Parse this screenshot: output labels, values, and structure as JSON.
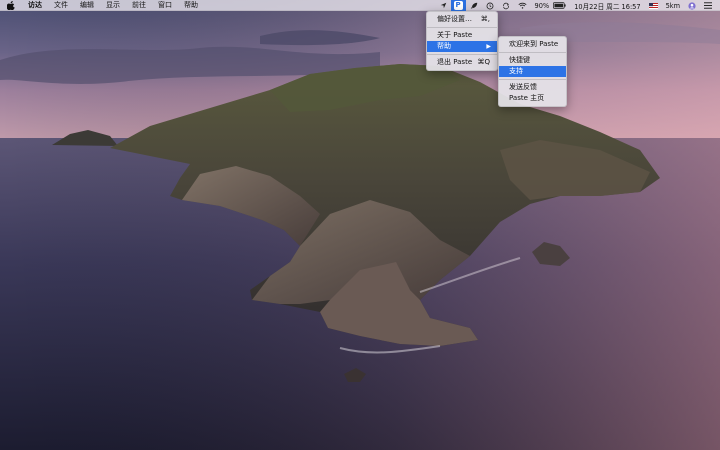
{
  "menubar": {
    "app_menus": [
      "访达",
      "文件",
      "编辑",
      "显示",
      "前往",
      "窗口",
      "帮助"
    ],
    "status": {
      "battery_percent": "90%",
      "datetime": "10月22日 周二 16:57",
      "weather": "5km"
    }
  },
  "paste_menu": {
    "preferences": "偏好设置…",
    "preferences_shortcut": "⌘,",
    "about": "关于 Paste",
    "help": "帮助",
    "quit": "退出 Paste",
    "quit_shortcut": "⌘Q"
  },
  "help_submenu": {
    "welcome": "欢迎来到 Paste",
    "shortcuts": "快捷键",
    "support": "支持",
    "feedback": "发送反馈",
    "homepage": "Paste 主页"
  },
  "icons": {
    "apple": "apple-icon",
    "location": "location-arrow-icon",
    "paste": "paste-app-icon",
    "rocket": "rocket-icon",
    "time_machine": "time-machine-icon",
    "sync": "sync-icon",
    "wifi": "wifi-icon",
    "battery": "battery-icon",
    "flag": "us-flag-icon",
    "user": "user-icon",
    "list": "notification-list-icon"
  },
  "colors": {
    "selection": "#2d73e6",
    "paste_active": "#2b6fe0"
  }
}
